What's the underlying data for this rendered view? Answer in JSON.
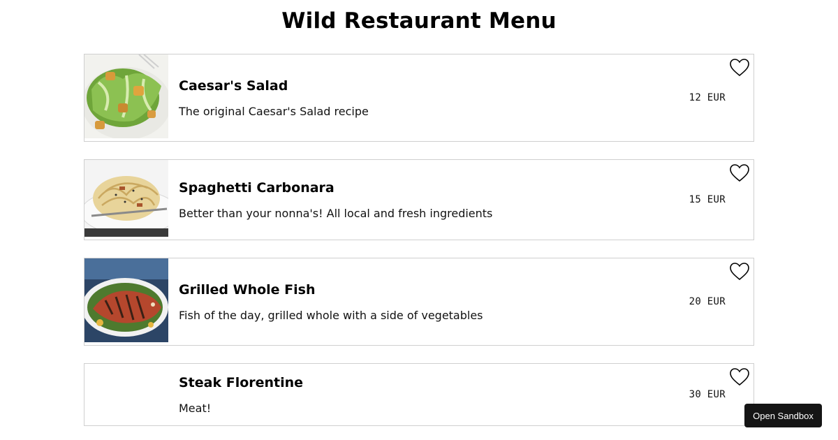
{
  "title": "Wild Restaurant Menu",
  "items": [
    {
      "name": "Caesar's Salad",
      "description": "The original Caesar's Salad recipe",
      "price": "12 EUR",
      "image": "caesar-salad-photo"
    },
    {
      "name": "Spaghetti Carbonara",
      "description": "Better than your nonna's! All local and fresh ingredients",
      "price": "15 EUR",
      "image": "spaghetti-carbonara-photo"
    },
    {
      "name": "Grilled Whole Fish",
      "description": "Fish of the day, grilled whole with a side of vegetables",
      "price": "20 EUR",
      "image": "grilled-fish-photo"
    },
    {
      "name": "Steak Florentine",
      "description": "Meat!",
      "price": "30 EUR",
      "image": ""
    }
  ],
  "sandbox_button": "Open Sandbox",
  "icons": {
    "favorite": "heart-outline-icon"
  },
  "colors": {
    "card_border": "#cfcfcf",
    "sandbox_bg": "#151515",
    "text": "#000000"
  }
}
